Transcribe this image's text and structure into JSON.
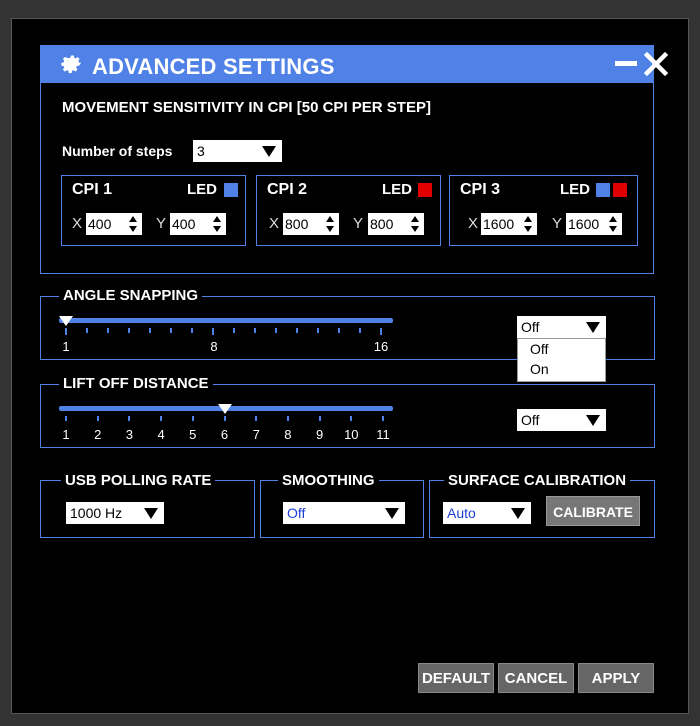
{
  "window": {
    "title": "ADVANCED SETTINGS"
  },
  "movement": {
    "heading": "MOVEMENT SENSITIVITY IN CPI  [50 CPI PER STEP]",
    "steps_label": "Number of steps",
    "steps_value": "3",
    "cpi": [
      {
        "title": "CPI 1",
        "led_label": "LED",
        "led_colors": [
          "#4f81e6"
        ],
        "x_label": "X",
        "y_label": "Y",
        "x": "400",
        "y": "400"
      },
      {
        "title": "CPI 2",
        "led_label": "LED",
        "led_colors": [
          "#e00000"
        ],
        "x_label": "X",
        "y_label": "Y",
        "x": "800",
        "y": "800"
      },
      {
        "title": "CPI 3",
        "led_label": "LED",
        "led_colors": [
          "#4f81e6",
          "#e00000"
        ],
        "x_label": "X",
        "y_label": "Y",
        "x": "1600",
        "y": "1600"
      }
    ]
  },
  "angle_snapping": {
    "label": "ANGLE SNAPPING",
    "scale_labels": [
      "1",
      "8",
      "16"
    ],
    "slider_value": 1,
    "select_value": "Off",
    "options": [
      "Off",
      "On"
    ]
  },
  "lift_off": {
    "label": "LIFT OFF DISTANCE",
    "scale_labels": [
      "1",
      "2",
      "3",
      "4",
      "5",
      "6",
      "7",
      "8",
      "9",
      "10",
      "11"
    ],
    "slider_value": 6,
    "select_value": "Off"
  },
  "usb_polling": {
    "label": "USB POLLING RATE",
    "value": "1000 Hz"
  },
  "smoothing": {
    "label": "SMOOTHING",
    "value": "Off"
  },
  "surface_calibration": {
    "label": "SURFACE CALIBRATION",
    "value": "Auto",
    "button": "CALIBRATE"
  },
  "buttons": {
    "default": "DEFAULT",
    "cancel": "CANCEL",
    "apply": "APPLY"
  }
}
